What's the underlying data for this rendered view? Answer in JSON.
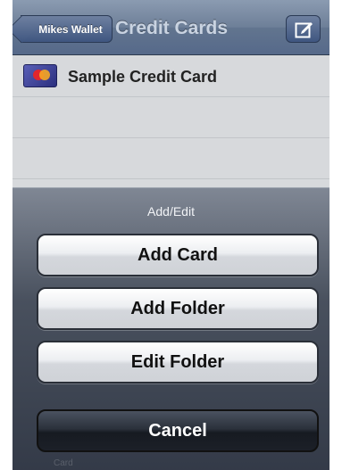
{
  "navbar": {
    "back_label": "Mikes Wallet",
    "title": "Credit Cards",
    "compose_icon": "compose-icon"
  },
  "list": {
    "items": [
      {
        "label": "Sample Credit Card",
        "icon": "credit-card-icon"
      }
    ]
  },
  "action_sheet": {
    "title": "Add/Edit",
    "buttons": [
      {
        "label": "Add Card"
      },
      {
        "label": "Add Folder"
      },
      {
        "label": "Edit Folder"
      }
    ],
    "cancel_label": "Cancel"
  },
  "tabbar": {
    "ghost_label": "Card"
  },
  "colors": {
    "navbar": "#6d7f98",
    "list_background": "#d7d9dc",
    "cancel_button": "#2b313b"
  }
}
